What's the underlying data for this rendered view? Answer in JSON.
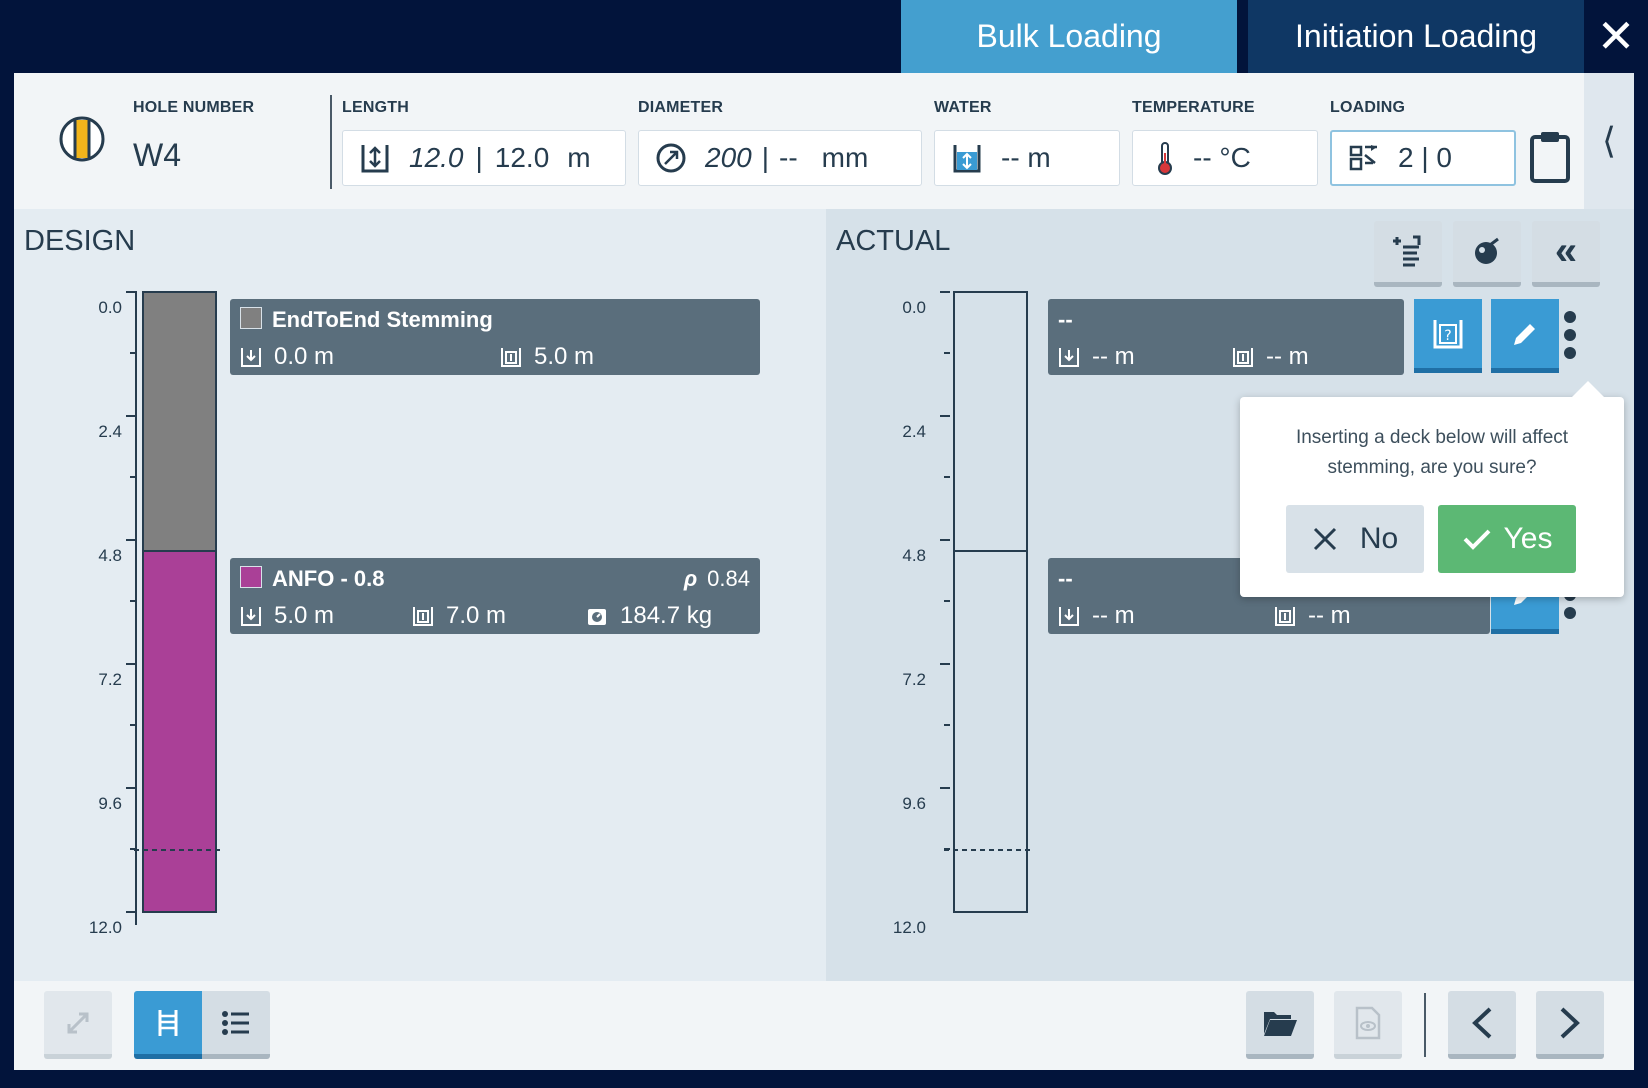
{
  "tabs": {
    "bulk_loading": "Bulk Loading",
    "initiation_loading": "Initiation Loading"
  },
  "colors": {
    "stemming": "#808080",
    "anfo": "#aa4097",
    "accent": "#3a9bd4",
    "confirm": "#5cb874"
  },
  "header": {
    "hole_number_label": "HOLE NUMBER",
    "hole_number": "W4",
    "length_label": "LENGTH",
    "length_design": "12.0",
    "length_sep": "|",
    "length_actual": "12.0",
    "length_unit": "m",
    "diameter_label": "DIAMETER",
    "diameter_design": "200",
    "diameter_sep": "|",
    "diameter_actual": "--",
    "diameter_unit": "mm",
    "water_label": "WATER",
    "water_value": "-- m",
    "temperature_label": "TEMPERATURE",
    "temperature_value": "-- °C",
    "loading_label": "LOADING",
    "loading_value": "2 | 0"
  },
  "design": {
    "title": "DESIGN",
    "axis_ticks": [
      "0.0",
      "2.4",
      "4.8",
      "7.2",
      "9.6",
      "12.0"
    ],
    "decks": [
      {
        "name": "EndToEnd Stemming",
        "top": "0.0 m",
        "length": "5.0 m"
      },
      {
        "name": "ANFO - 0.8",
        "density_label": "ρ",
        "density": "0.84",
        "top": "5.0 m",
        "length": "7.0 m",
        "mass": "184.7 kg"
      }
    ]
  },
  "actual": {
    "title": "ACTUAL",
    "axis_ticks": [
      "0.0",
      "2.4",
      "4.8",
      "7.2",
      "9.6",
      "12.0"
    ],
    "decks": [
      {
        "name": "--",
        "top": "-- m",
        "length": "-- m"
      },
      {
        "name": "--",
        "top": "-- m",
        "length": "-- m"
      }
    ]
  },
  "popup": {
    "message": "Inserting a deck below will affect stemming, are you sure?",
    "no_label": "No",
    "yes_label": "Yes"
  }
}
